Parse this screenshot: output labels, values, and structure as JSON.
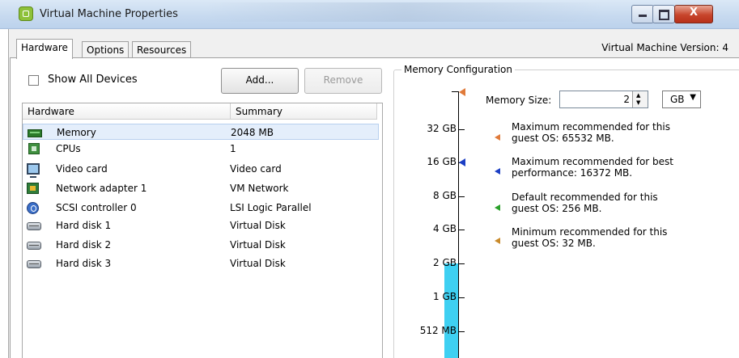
{
  "window": {
    "title": "Virtual Machine Properties",
    "minimize_glyph": "",
    "maximize_glyph": "",
    "close_glyph": "X"
  },
  "tabs": [
    {
      "label": "Hardware",
      "active": true
    },
    {
      "label": "Options",
      "active": false
    },
    {
      "label": "Resources",
      "active": false
    }
  ],
  "vm_version": "Virtual Machine Version: 4",
  "hardware": {
    "show_all_devices_label": "Show All Devices",
    "show_all_devices_checked": false,
    "add_label": "Add...",
    "remove_label": "Remove",
    "columns": [
      "Hardware",
      "Summary"
    ],
    "rows": [
      {
        "icon": "memory-icon",
        "name": "Memory",
        "summary": "2048 MB",
        "selected": true
      },
      {
        "icon": "cpu-icon",
        "name": "CPUs",
        "summary": "1",
        "selected": false
      },
      {
        "icon": "monitor-icon",
        "name": "Video card",
        "summary": "Video card",
        "selected": false
      },
      {
        "icon": "network-adapter-icon",
        "name": "Network adapter 1",
        "summary": "VM Network",
        "selected": false
      },
      {
        "icon": "scsi-controller-icon",
        "name": "SCSI controller 0",
        "summary": "LSI Logic Parallel",
        "selected": false
      },
      {
        "icon": "hard-disk-icon",
        "name": "Hard disk 1",
        "summary": "Virtual Disk",
        "selected": false
      },
      {
        "icon": "hard-disk-icon",
        "name": "Hard disk 2",
        "summary": "Virtual Disk",
        "selected": false
      },
      {
        "icon": "hard-disk-icon",
        "name": "Hard disk 3",
        "summary": "Virtual Disk",
        "selected": false
      }
    ]
  },
  "memory": {
    "group_title": "Memory Configuration",
    "size_label": "Memory Size:",
    "size_value": "2",
    "unit": "GB",
    "spin_up": "▲",
    "spin_down": "▼",
    "unit_arrow": "▼",
    "scale_labels": [
      "32 GB",
      "16 GB",
      "8 GB",
      "4 GB",
      "2 GB",
      "1 GB",
      "512 MB"
    ],
    "notes": [
      {
        "color": "#e07a3a",
        "line1": "Maximum recommended for this",
        "line2": "guest OS: 65532 MB."
      },
      {
        "color": "#1c3fc4",
        "line1": "Maximum recommended for best",
        "line2": "performance: 16372 MB."
      },
      {
        "color": "#2aa02a",
        "line1": "Default recommended for this",
        "line2": "guest OS: 256 MB."
      },
      {
        "color": "#c98a2a",
        "line1": "Minimum recommended for this",
        "line2": "guest OS: 32 MB."
      }
    ]
  },
  "colors": {
    "bar_fill": "#3ed0f2",
    "selection": "#e4eefb",
    "title_bar": "#c6d9ef"
  }
}
